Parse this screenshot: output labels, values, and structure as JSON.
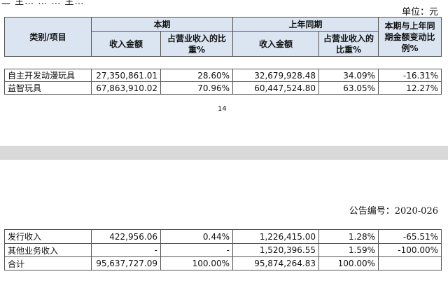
{
  "cut_top_text": "二 主…  …  … 主…",
  "unit_label": "单位：元",
  "table": {
    "header": {
      "category": "类别/项目",
      "current_period": "本期",
      "prior_period": "上年同期",
      "change": "本期与上年同期金额变动比例%",
      "revenue_amount": "收入金额",
      "share_of_revenue": "占营业收入的比重%"
    },
    "rows_top": [
      {
        "category": "自主开发动漫玩具",
        "cur_amount": "27,350,861.01",
        "cur_share": "28.60%",
        "prev_amount": "32,679,928.48",
        "prev_share": "34.09%",
        "change": "-16.31%"
      },
      {
        "category": "益智玩具",
        "cur_amount": "67,863,910.02",
        "cur_share": "70.96%",
        "prev_amount": "60,447,524.80",
        "prev_share": "63.05%",
        "change": "12.27%"
      }
    ],
    "rows_bottom": [
      {
        "category": "发行收入",
        "cur_amount": "422,956.06",
        "cur_share": "0.44%",
        "prev_amount": "1,226,415.00",
        "prev_share": "1.28%",
        "change": "-65.51%"
      },
      {
        "category": "其他业务收入",
        "cur_amount": "-",
        "cur_share": "-",
        "prev_amount": "1,520,396.55",
        "prev_share": "1.59%",
        "change": "-100.00%"
      },
      {
        "category": "合计",
        "cur_amount": "95,637,727.09",
        "cur_share": "100.00%",
        "prev_amount": "95,874,264.83",
        "prev_share": "100.00%",
        "change": ""
      }
    ]
  },
  "page_number": "14",
  "announcement_code": "公告编号：2020-026",
  "colors": {
    "header_bg": "#dbe5f1",
    "page_gap": "#d9d9d9",
    "border": "#555555"
  }
}
